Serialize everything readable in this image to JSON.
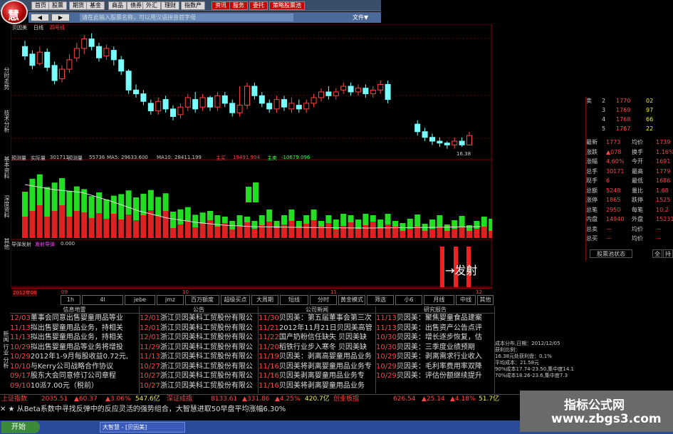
{
  "menu": [
    "首页",
    "股票",
    "期货",
    "基金",
    "商品",
    "债券",
    "外汇",
    "理财",
    "指数产",
    "资讯",
    "服务",
    "委托",
    "策略股票池"
  ],
  "cmd": {
    "back": "◀",
    "fwd": "▶",
    "search": "请在此输入股票名称，可以用汉语拼音首字母",
    "file": "文件▼"
  },
  "stock": {
    "name": "贝因美",
    "period": "日线",
    "chart": "四号线"
  },
  "left_tabs": [
    "分时走势",
    "技术分析",
    "基本资料",
    "深度资料",
    "其他"
  ],
  "vol_header": {
    "a": "预测量",
    "b": "实际量",
    "c": "301711",
    "d": "预测量",
    "e": "55736",
    "f": "MA5:",
    "g": "29633.600",
    "h": "MA10:",
    "i": "28411.199",
    "j": "主买",
    "k": "19491.904",
    "l": "主卖",
    "m": "-10679.096"
  },
  "signal_header": {
    "a": "导弹发射",
    "b": "发射导弹",
    "c": "0.000"
  },
  "signal_label": "→发射",
  "low_price": "16.38",
  "date_tag": "2012年08",
  "date_tag2": "09",
  "date_tag3": "10",
  "date_tag4": "11",
  "date_tag5": "12",
  "chart_data": {
    "type": "candlestick",
    "candles": [
      [
        0,
        21.6,
        21.1,
        21.9,
        20.9
      ],
      [
        1,
        21.2,
        20.6,
        21.4,
        20.4
      ],
      [
        2,
        20.7,
        21.3,
        21.6,
        20.6
      ],
      [
        3,
        21.3,
        20.5,
        21.5,
        20.3
      ],
      [
        4,
        20.6,
        19.8,
        20.8,
        19.6
      ],
      [
        5,
        19.9,
        20.4,
        20.6,
        19.7
      ],
      [
        6,
        20.4,
        20.9,
        21.2,
        20.2
      ],
      [
        7,
        21.0,
        21.5,
        21.8,
        20.8
      ],
      [
        8,
        21.5,
        22.0,
        22.2,
        21.2
      ],
      [
        9,
        22.0,
        21.6,
        22.3,
        21.4
      ],
      [
        10,
        21.6,
        21.0,
        21.8,
        20.8
      ],
      [
        11,
        21.1,
        21.5,
        21.7,
        20.9
      ],
      [
        12,
        21.4,
        20.9,
        21.6,
        20.6
      ],
      [
        13,
        20.9,
        20.3,
        21.1,
        20.1
      ],
      [
        14,
        20.3,
        19.3,
        20.4,
        19.1
      ],
      [
        15,
        19.3,
        19.1,
        19.6,
        18.9
      ],
      [
        16,
        19.1,
        18.7,
        19.3,
        18.5
      ],
      [
        17,
        18.6,
        18.2,
        18.8,
        18.0
      ],
      [
        18,
        18.2,
        18.7,
        18.9,
        18.0
      ],
      [
        19,
        18.8,
        18.3,
        19.0,
        18.1
      ],
      [
        20,
        18.3,
        17.9,
        18.5,
        17.7
      ],
      [
        21,
        18.0,
        18.4,
        18.6,
        17.8
      ],
      [
        22,
        18.4,
        18.9,
        19.1,
        18.2
      ],
      [
        23,
        18.8,
        18.3,
        19.2,
        18.1
      ],
      [
        24,
        18.4,
        18.9,
        19.1,
        18.2
      ],
      [
        25,
        18.9,
        18.4,
        19.0,
        18.2
      ],
      [
        26,
        18.4,
        19.0,
        19.2,
        18.2
      ],
      [
        27,
        19.0,
        18.6,
        19.2,
        18.4
      ],
      [
        28,
        18.6,
        18.1,
        18.8,
        17.9
      ],
      [
        29,
        18.1,
        18.5,
        19.5,
        17.9
      ],
      [
        30,
        18.5,
        19.5,
        19.7,
        18.3
      ],
      [
        31,
        19.5,
        19.0,
        19.7,
        18.8
      ],
      [
        32,
        19.0,
        18.6,
        19.2,
        18.4
      ],
      [
        33,
        18.6,
        18.3,
        18.8,
        18.1
      ],
      [
        34,
        18.3,
        18.8,
        19.0,
        18.1
      ],
      [
        35,
        18.8,
        18.4,
        19.0,
        18.2
      ],
      [
        36,
        18.3,
        18.6,
        18.9,
        18.1
      ],
      [
        37,
        18.5,
        18.3,
        18.8,
        18.1
      ],
      [
        38,
        18.3,
        18.6,
        18.8,
        18.1
      ],
      [
        39,
        18.6,
        18.9,
        19.1,
        18.4
      ],
      [
        40,
        18.9,
        19.2,
        19.4,
        18.7
      ],
      [
        41,
        19.2,
        19.0,
        19.5,
        18.8
      ],
      [
        42,
        19.0,
        19.2,
        19.4,
        18.8
      ],
      [
        43,
        19.3,
        19.5,
        19.7,
        19.1
      ],
      [
        44,
        19.5,
        19.2,
        19.7,
        19.0
      ],
      [
        45,
        19.2,
        19.4,
        19.6,
        19.0
      ],
      [
        46,
        19.4,
        19.1,
        19.6,
        18.9
      ],
      [
        47,
        19.1,
        19.3,
        19.5,
        18.9
      ],
      [
        48,
        19.3,
        19.6,
        19.8,
        19.1
      ],
      [
        49,
        19.6,
        18.8,
        19.8,
        18.6
      ],
      [
        53,
        17.5,
        17.1,
        17.7,
        16.9
      ],
      [
        54,
        17.1,
        16.8,
        17.3,
        16.6
      ],
      [
        55,
        16.8,
        16.6,
        17.0,
        16.4
      ],
      [
        56,
        16.6,
        16.5,
        16.8,
        16.3
      ],
      [
        57,
        16.5,
        16.4,
        16.6,
        16.2
      ],
      [
        58,
        16.4,
        16.6,
        16.8,
        16.2
      ],
      [
        59,
        16.6,
        16.4,
        16.8,
        16.3
      ],
      [
        60,
        16.4,
        16.9,
        17.1,
        16.38
      ]
    ]
  },
  "quote": {
    "rows": [
      [
        "卖",
        "2",
        "1770",
        "02"
      ],
      [
        "",
        "3",
        "1769",
        "97"
      ],
      [
        "",
        "4",
        "1768",
        "66"
      ],
      [
        "",
        "5",
        "1767",
        "22"
      ]
    ],
    "stats": [
      [
        "最新",
        "1773",
        "均价",
        "1739"
      ],
      [
        "涨跌",
        "▲078",
        "换手",
        "1.16%"
      ],
      [
        "涨幅",
        "4.60%",
        "今开",
        "1691"
      ],
      [
        "总手",
        "30171",
        "最高",
        "1779"
      ],
      [
        "现手",
        "6",
        "最低",
        "1686"
      ],
      [
        "总额",
        "5248",
        "量比",
        "1.68"
      ],
      [
        "涨停",
        "1865",
        "跌停",
        "1525"
      ],
      [
        "总笔",
        "2950",
        "每笔",
        "10.2"
      ],
      [
        "内盘",
        "14940",
        "外盘",
        "15231"
      ],
      [
        "总卖",
        "－",
        "均价",
        "－"
      ],
      [
        "总买",
        "－",
        "均价",
        "－"
      ]
    ],
    "btns": [
      "股票池状态",
      "全",
      "持"
    ]
  },
  "tabs": [
    "1h",
    "4l",
    "jebe",
    "jmz",
    "百万额度",
    "超级买点",
    "大周期",
    "短线",
    "分时",
    "黄金模式",
    "筛选",
    "小6",
    "月线",
    "中线",
    "其他"
  ],
  "news": {
    "col1": {
      "head": "信息地雷",
      "rows": [
        [
          "12/03",
          "董事会同意出售婴童用品等业"
        ],
        [
          "11/13",
          "拟出售婴童用品业务，持相关"
        ],
        [
          "11/13",
          "拟出售婴童用品业务，持相关"
        ],
        [
          "10/29",
          "拟出售婴童用品等业务将增投"
        ],
        [
          "10/29",
          "2012年1-9月每股收益0.72元,"
        ],
        [
          "10/10",
          "与Kerry公司战略合作协议"
        ],
        [
          "09/17",
          "股东大会同意修订公司章程"
        ],
        [
          "09/10",
          "10派7.00元（税前）"
        ]
      ]
    },
    "col2": {
      "head": "公告",
      "rows": [
        [
          "12/01",
          "浙江贝因美科工贸股份有限公"
        ],
        [
          "12/01",
          "浙江贝因美科工贸股份有限公"
        ],
        [
          "12/01",
          "浙江贝因美科工贸股份有限公"
        ],
        [
          "11/29",
          "浙江贝因美科工贸股份有限公"
        ],
        [
          "11/13",
          "浙江贝因美科工贸股份有限公"
        ],
        [
          "10/27",
          "浙江贝因美科工贸股份有限公"
        ],
        [
          "10/27",
          "浙江贝因美科工贸股份有限公"
        ],
        [
          "10/27",
          "浙江贝因美科工贸股份有限公"
        ]
      ]
    },
    "col3": {
      "head": "公司新闻",
      "rows": [
        [
          "11/30",
          "贝因美：第五届董事会第三次"
        ],
        [
          "11/21",
          "2012年11月21日贝因美高管"
        ],
        [
          "11/22",
          "国产奶粉信任缺失 贝因美缺"
        ],
        [
          "11/20",
          "稻铁行业步入寒冬 贝因美缺"
        ],
        [
          "11/19",
          "贝因美：剥离高婴童用品业务"
        ],
        [
          "11/16",
          "贝因美将剥离婴童用品业务专"
        ],
        [
          "11/16",
          "贝因美剥离婴童用品业务专"
        ],
        [
          "11/16",
          "贝因美将剥离婴童用品业务"
        ]
      ]
    },
    "col4": {
      "head": "研究报告",
      "rows": [
        [
          "11/13",
          "贝因美：聚焦婴童食品建案"
        ],
        [
          "11/13",
          "贝因美：出售资产公告点评"
        ],
        [
          "10/30",
          "贝因美：增长逐步恢复，估"
        ],
        [
          "10/30",
          "贝因美：三季度业绩预期"
        ],
        [
          "10/29",
          "贝因美：剥离需求行业收入"
        ],
        [
          "10/29",
          "贝因美：毛利率费用率双降"
        ],
        [
          "10/29",
          "贝因美：评估份额继续提升"
        ]
      ]
    }
  },
  "info": [
    "成本分布,日期：2012/12/05",
    "获利比例：",
    "16.38元处获利盘：0.1%",
    "平均成本：21.58元",
    "90%成本17.74-23.50,集中度14.1",
    "70%成本18.26-23.6,集中度7.3"
  ],
  "ticker": [
    [
      "上证指数",
      "#f44"
    ],
    [
      "2035.51",
      "#f44"
    ],
    [
      "▲60.37",
      "#f44"
    ],
    [
      "▲3.06%",
      "#f44"
    ],
    [
      "547.6亿",
      "#ee4"
    ],
    [
      "深证成指",
      "#f44"
    ],
    [
      "8133.61",
      "#f44"
    ],
    [
      "▲331.86",
      "#f44"
    ],
    [
      "▲4.25%",
      "#f44"
    ],
    [
      "420.7亿",
      "#ee4"
    ],
    [
      "创业板指",
      "#f44"
    ],
    [
      "626.54",
      "#f44"
    ],
    [
      "▲25.14",
      "#f44"
    ],
    [
      "▲4.18%",
      "#f44"
    ],
    [
      "51.7亿",
      "#ee4"
    ]
  ],
  "scroll": "✕ ★ 从Beta系数中寻找反弹中的反应灵活的强势组合，大智慧进取50早盘平均涨幅6.30%",
  "taskbar": {
    "start": "开始",
    "tasks": [
      "大智慧 - [贝因美]"
    ]
  },
  "watermark": {
    "line1": "指标公式网",
    "line2": "www.zbgs3.com"
  }
}
